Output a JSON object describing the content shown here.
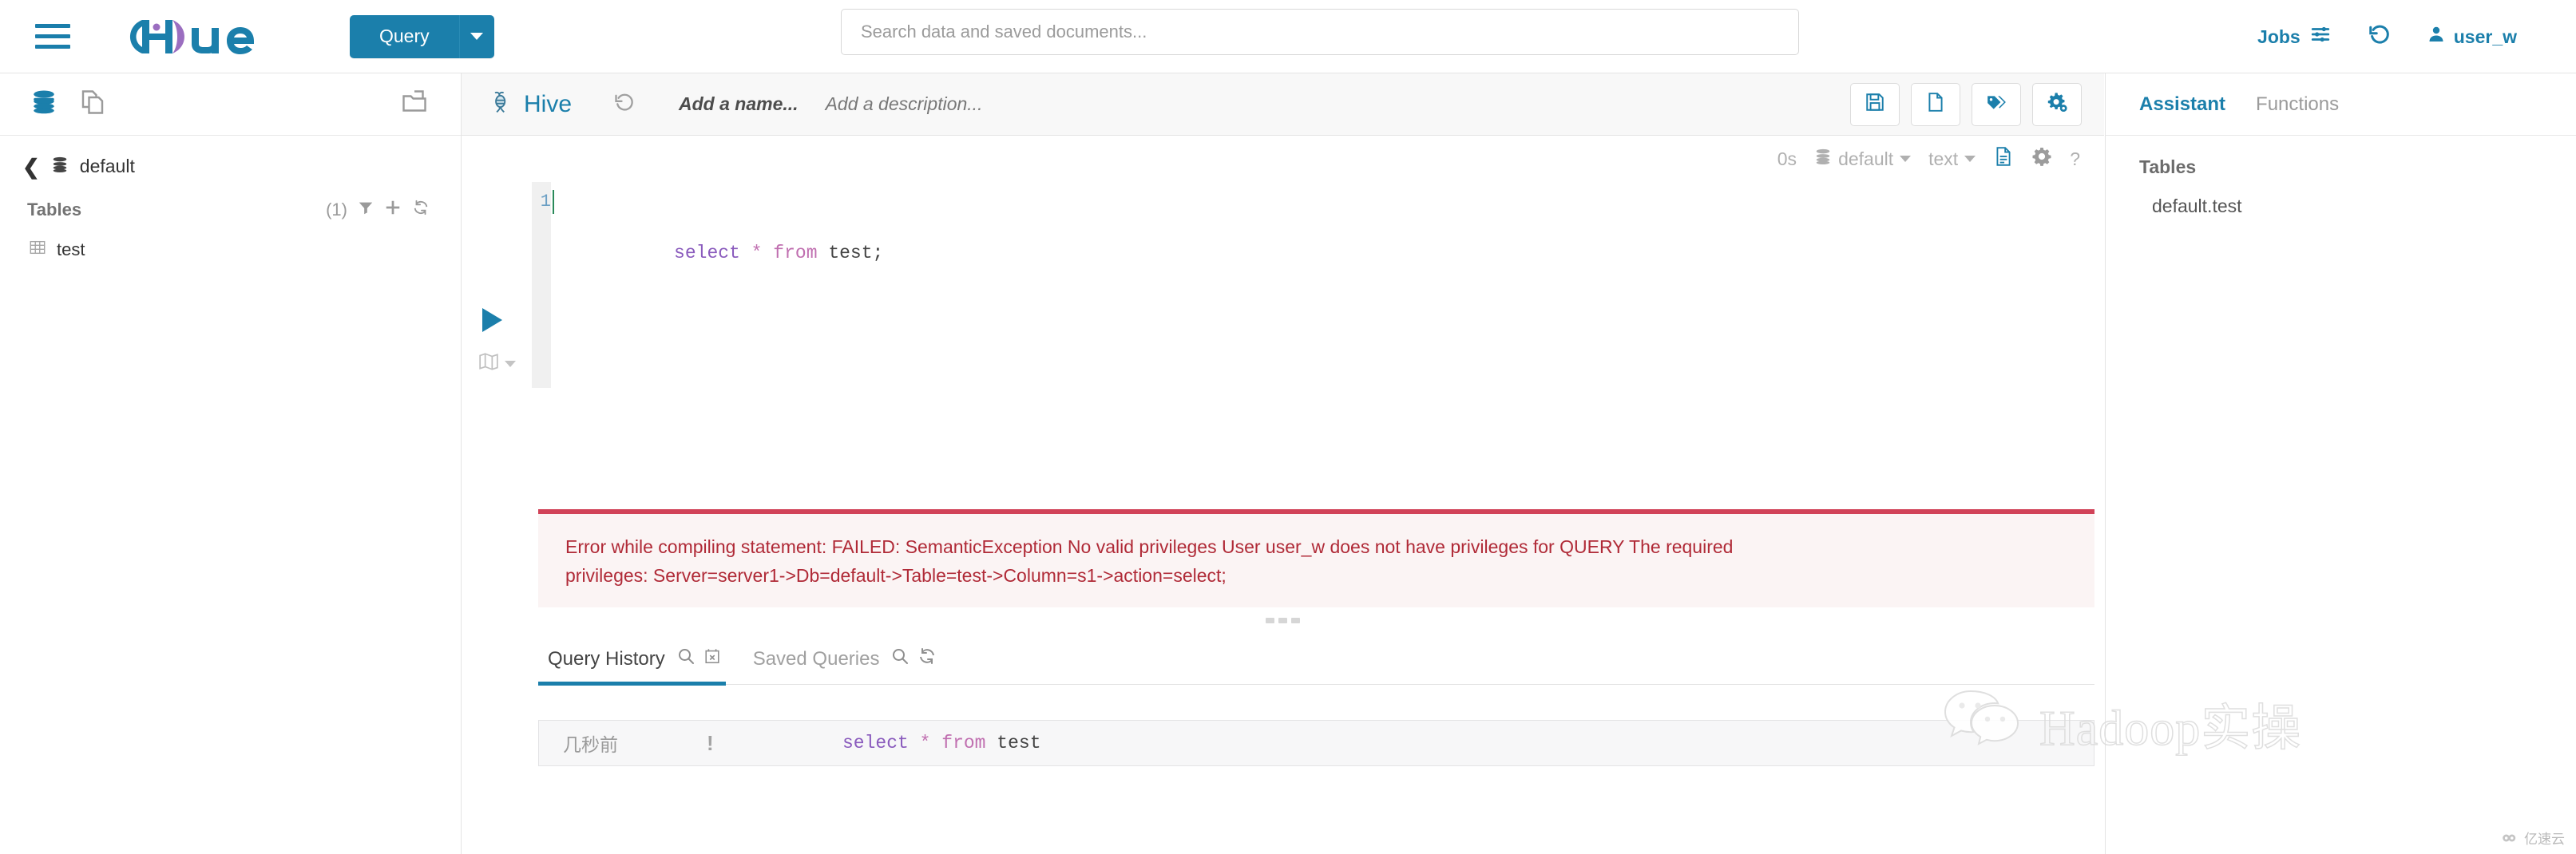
{
  "navbar": {
    "menu_icon": "hamburger-menu-icon",
    "brand": "Hue",
    "query_button": "Query",
    "query_caret_icon": "chevron-down-icon",
    "search_placeholder": "Search data and saved documents...",
    "search_value": "",
    "jobs_label": "Jobs",
    "jobs_icon": "sliders-icon",
    "history_icon": "history-undo-icon",
    "user_icon": "user-icon",
    "user_name": "user_w"
  },
  "sidebar": {
    "top_icons": [
      "database-icon",
      "documents-icon",
      "folder-open-icon"
    ],
    "back_icon": "chevron-left-icon",
    "database_icon": "database-icon",
    "database_name": "default",
    "tables_label": "Tables",
    "tables_count": "(1)",
    "filter_icon": "filter-icon",
    "add_icon": "plus-icon",
    "refresh_icon": "refresh-icon",
    "tables": [
      {
        "icon": "table-icon",
        "name": "test"
      }
    ]
  },
  "editor": {
    "engine_icon": "hive-bee-icon",
    "engine_name": "Hive",
    "undo_icon": "history-undo-icon",
    "name_placeholder": "Add a name...",
    "description_placeholder": "Add a description...",
    "header_buttons": [
      {
        "icon": "save-floppy-icon",
        "name": "save-button"
      },
      {
        "icon": "new-document-icon",
        "name": "new-document-button"
      },
      {
        "icon": "tags-icon",
        "name": "tags-button"
      },
      {
        "icon": "gears-icon",
        "name": "settings-button"
      }
    ],
    "settings": {
      "elapsed": "0s",
      "database_icon": "database-icon",
      "database": "default",
      "format": "text",
      "doc_icon": "document-icon",
      "gear_icon": "gear-icon",
      "help_icon": "question-mark-icon"
    },
    "run_icon": "play-triangle-icon",
    "map_icon": "map-icon",
    "line_numbers": [
      "1"
    ],
    "code": {
      "select": "select",
      "star": "*",
      "from": "from",
      "table": "test;",
      "full": "select * from test;"
    }
  },
  "error": {
    "line1": "Error while compiling statement: FAILED: SemanticException No valid privileges User user_w does not have privileges for QUERY The required",
    "line2": "privileges: Server=server1->Db=default->Table=test->Column=s1->action=select;",
    "accent_color": "#d14258",
    "text_color": "#b02a37",
    "background": "#fbf4f4"
  },
  "results": {
    "drag_handle_icon": "drag-dots-icon",
    "tabs": [
      {
        "label": "Query History",
        "active": true,
        "icons": [
          "search-icon",
          "calendar-clear-icon"
        ]
      },
      {
        "label": "Saved Queries",
        "active": false,
        "icons": [
          "search-icon",
          "refresh-icon"
        ]
      }
    ],
    "history_rows": [
      {
        "time": "几秒前",
        "status": "!",
        "query_select": "select",
        "query_star": "*",
        "query_from": "from",
        "query_table": "test"
      }
    ]
  },
  "assistant": {
    "tabs": [
      {
        "label": "Assistant",
        "active": true
      },
      {
        "label": "Functions",
        "active": false
      }
    ],
    "section_title": "Tables",
    "entries": [
      "default.test"
    ]
  },
  "watermark": {
    "icon": "wechat-icon",
    "text": "Hadoop实操",
    "badge": "亿速云"
  },
  "colors": {
    "brand_blue": "#1b7fab",
    "logo_purple": "#9b6ec0",
    "error_red": "#d14258",
    "keyword_purple": "#8a5bbd"
  }
}
